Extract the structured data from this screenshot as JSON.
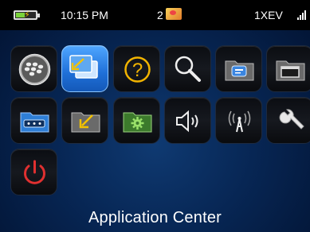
{
  "status_bar": {
    "time": "10:15 PM",
    "message_count": "2",
    "network": "1XEV",
    "icons": [
      "battery-charging-icon",
      "message-icon",
      "signal-strength-icon"
    ]
  },
  "app_grid": [
    {
      "icon": "blackberry-logo-icon"
    },
    {
      "icon": "switch-application-icon",
      "selected": true
    },
    {
      "icon": "help-icon"
    },
    {
      "icon": "search-icon"
    },
    {
      "icon": "messages-folder-icon"
    },
    {
      "icon": "window-folder-icon"
    },
    {
      "icon": "media-folder-icon"
    },
    {
      "icon": "downloads-folder-icon"
    },
    {
      "icon": "settings-folder-icon"
    },
    {
      "icon": "sound-icon"
    },
    {
      "icon": "manage-connections-icon"
    },
    {
      "icon": "options-wrench-icon"
    },
    {
      "icon": "power-icon"
    }
  ],
  "selected_label": "Application Center",
  "colors": {
    "selected_tile": "#2f86ee",
    "power_red": "#e03030",
    "folder_green": "#3c7a2c",
    "folder_blue": "#2e7ed6"
  }
}
